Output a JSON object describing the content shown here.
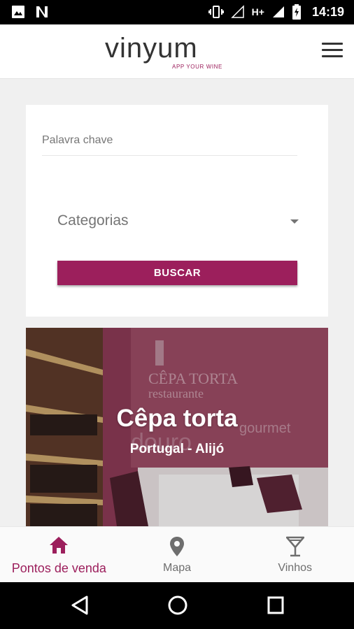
{
  "status_bar": {
    "time": "14:19",
    "network": "H+",
    "icons": [
      "image-icon",
      "notification-n-icon",
      "vibrate-icon",
      "signal-icon",
      "battery-charging-icon"
    ]
  },
  "header": {
    "logo_text": "vinyum",
    "logo_tagline": "APP YOUR WINE",
    "menu_icon": "hamburger-menu-icon"
  },
  "search": {
    "keyword_label": "Palavra chave",
    "keyword_value": "",
    "category_placeholder": "Categorias",
    "button_label": "BUSCAR"
  },
  "stores": [
    {
      "name": "Cêpa torta",
      "location": "Portugal - Alijó",
      "image": "restaurant-interior-photo"
    }
  ],
  "bottom_nav": {
    "items": [
      {
        "label": "Pontos de venda",
        "icon": "home-icon",
        "active": true
      },
      {
        "label": "Mapa",
        "icon": "map-pin-icon",
        "active": false
      },
      {
        "label": "Vinhos",
        "icon": "wine-glass-icon",
        "active": false
      }
    ]
  },
  "colors": {
    "accent": "#9c1f5c",
    "inactive": "#6e6e6e",
    "background": "#f0f0f0"
  }
}
